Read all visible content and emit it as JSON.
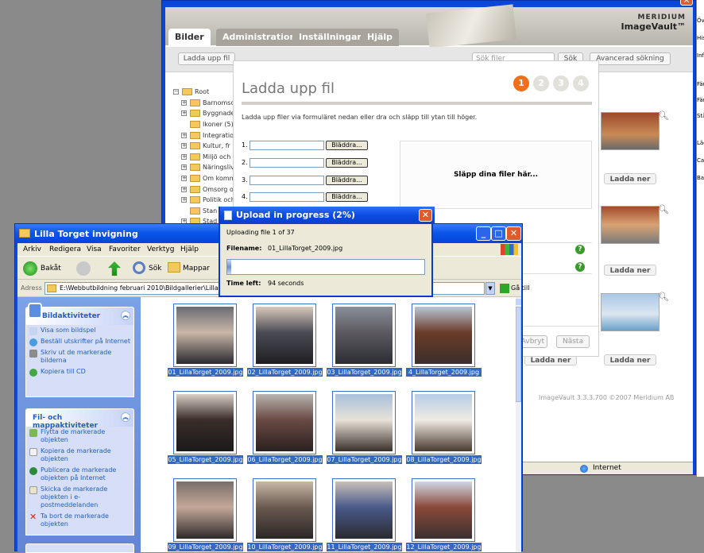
{
  "ie": {
    "tabs": [
      "Bilder",
      "Administration",
      "Inställningar",
      "Hjälp"
    ],
    "logo": {
      "line1": "MERIDIUM",
      "line2": "ImageVault™"
    },
    "upload_btn": "Ladda upp fil",
    "search_placeholder": "Sök filer",
    "search_btn": "Sök",
    "advanced_btn": "Avancerad sökning",
    "tree": {
      "root": "Root",
      "items": [
        "Barnomsorg",
        "Byggnader",
        "Ikoner (5)",
        "Integration",
        "Kultur, fr",
        "Miljö och",
        "Näringsliv",
        "Om kommun",
        "Omsorg o",
        "Politik och",
        "Stan",
        "Stad"
      ]
    },
    "download_label": "Ladda ner",
    "footer": "ImageVault 3.3.3.700 ©2007 Meridium AB",
    "status": "Internet",
    "right_strip": [
      "Öve",
      "His",
      "Info",
      "Fän",
      "Fän",
      "Stå",
      "Läg",
      "Can",
      "Ban"
    ]
  },
  "upload": {
    "title": "Ladda upp fil",
    "steps": [
      "1",
      "2",
      "3",
      "4"
    ],
    "instructions": "Ladda upp filer via formuläret nedan eller dra och släpp till ytan till höger.",
    "rows": [
      "1.",
      "2.",
      "3.",
      "4."
    ],
    "browse": "Bläddra...",
    "drop": "Släpp dina filer här...",
    "cancel": "Avbryt",
    "next": "Nästa"
  },
  "progress": {
    "title": "Upload in progress (2%)",
    "line1": "Uploading file 1 of 37",
    "filename_label": "Filename:",
    "filename": "01_LillaTorget_2009.jpg",
    "percent": 2,
    "timeleft_label": "Time left:",
    "timeleft": "94 seconds"
  },
  "explorer": {
    "title": "Lilla Torget invigning",
    "menu": [
      "Arkiv",
      "Redigera",
      "Visa",
      "Favoriter",
      "Verktyg",
      "Hjälp"
    ],
    "back": "Bakåt",
    "search": "Sök",
    "folders": "Mappar",
    "address_label": "Adress",
    "address": "E:\\Webbutbildning februari 2010\\Bildgallerier\\Lilla Torget",
    "go": "Gå till",
    "pic_tasks": {
      "title": "Bildaktiviteter",
      "items": [
        "Visa som bildspel",
        "Beställ utskrifter på Internet",
        "Skriv ut de markerade bilderna",
        "Kopiera till CD"
      ]
    },
    "file_tasks": {
      "title": "Fil- och mappaktiviteter",
      "items": [
        "Flytta de markerade objekten",
        "Kopiera de markerade objekten",
        "Publicera de markerade objekten på Internet",
        "Skicka de markerade objekten i e-postmeddelanden",
        "Ta bort de markerade objekten"
      ]
    },
    "files": [
      "01_LillaTorget_2009.jpg",
      "02_LillaTorget_2009.jpg",
      "03_LillaTorget_2009.jpg",
      "4_LillaTorget_2009.jpg",
      "05_LillaTorget_2009.jpg",
      "06_LillaTorget_2009.jpg",
      "07_LillaTorget_2009.jpg",
      "08_LillaTorget_2009.jpg",
      "09_LillaTorget_2009.jpg",
      "10_LillaTorget_2009.jpg",
      "11_LillaTorget_2009.jpg",
      "12_LillaTorget_2009.jpg"
    ]
  }
}
